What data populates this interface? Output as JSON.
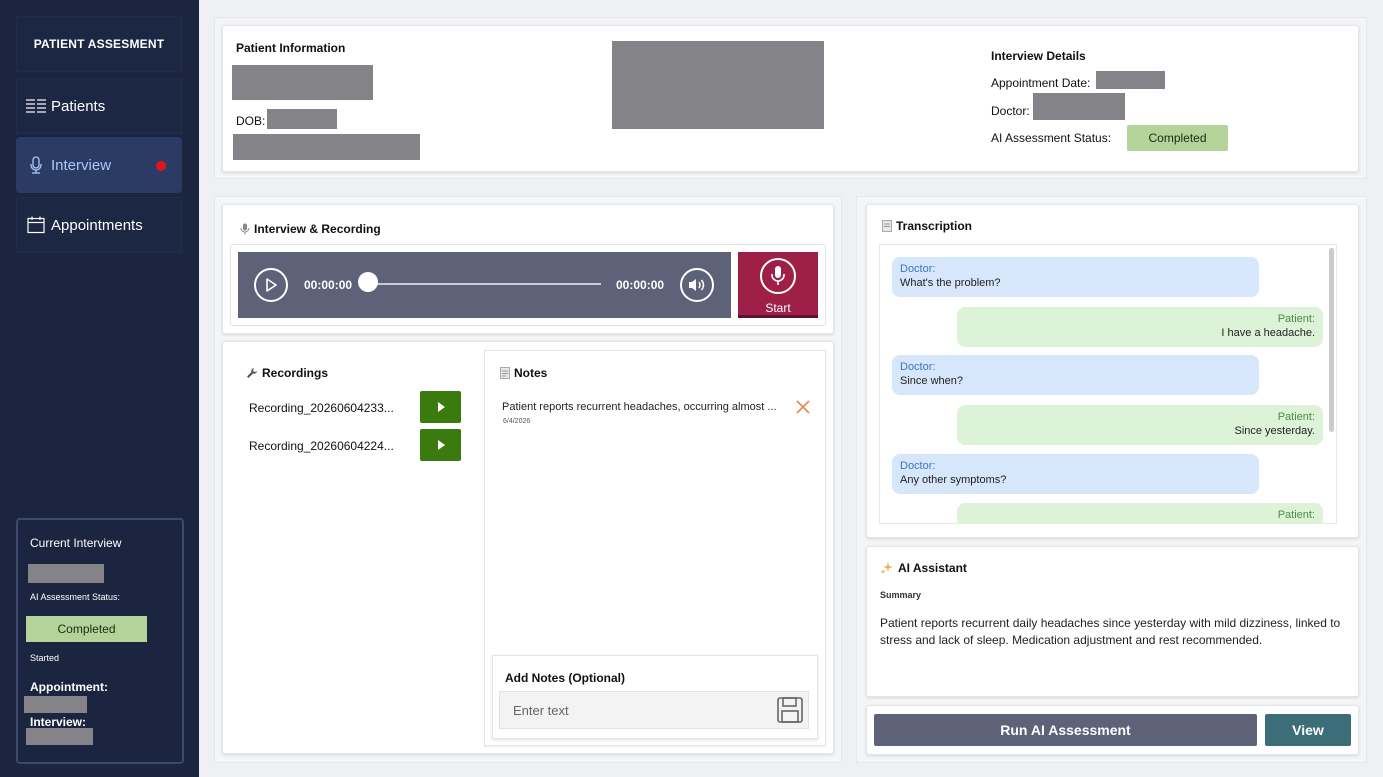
{
  "sidebar": {
    "brand": "PATIENT ASSESMENT",
    "items": [
      {
        "label": "Patients",
        "icon": "list-icon"
      },
      {
        "label": "Interview",
        "icon": "microphone-icon"
      },
      {
        "label": "Appointments",
        "icon": "calendar-icon"
      }
    ],
    "current": {
      "title": "Current Interview",
      "ai_status_label": "AI Assessment Status:",
      "ai_status": "Completed",
      "started": "Started",
      "appointment_label": "Appointment:",
      "interview_label": "Interview:"
    }
  },
  "patient_info": {
    "title": "Patient Information",
    "dob_label": "DOB:"
  },
  "interview_details": {
    "title": "Interview Details",
    "appointment_date_label": "Appointment Date:",
    "doctor_label": "Doctor:",
    "ai_status_label": "AI Assessment Status:",
    "ai_status": "Completed"
  },
  "recording": {
    "title": "Interview & Recording",
    "time_current": "00:00:00",
    "time_total": "00:00:00",
    "start_label": "Start"
  },
  "recordings": {
    "title": "Recordings",
    "items": [
      "Recording_20260604233...",
      "Recording_20260604224..."
    ]
  },
  "notes": {
    "title": "Notes",
    "items": [
      {
        "text": "Patient reports recurrent headaches, occurring almost ...",
        "date": "6/4/2026"
      }
    ],
    "add_title": "Add Notes (Optional)",
    "placeholder": "Enter text"
  },
  "transcription": {
    "title": "Transcription",
    "messages": [
      {
        "speaker": "Doctor:",
        "text": "What's the problem?"
      },
      {
        "speaker": "Patient:",
        "text": "I have a headache."
      },
      {
        "speaker": "Doctor:",
        "text": "Since when?"
      },
      {
        "speaker": "Patient:",
        "text": "Since yesterday."
      },
      {
        "speaker": "Doctor:",
        "text": "Any other symptoms?"
      },
      {
        "speaker": "Patient:",
        "text": ""
      }
    ]
  },
  "ai_assistant": {
    "title": "AI Assistant",
    "summary_label": "Summary",
    "summary": "Patient reports recurrent daily headaches since yesterday with mild dizziness, linked to stress and lack of sleep. Medication adjustment and rest recommended."
  },
  "actions": {
    "run_label": "Run AI Assessment",
    "view_label": "View"
  },
  "colors": {
    "sidebar_bg": "#1b2540",
    "active_nav": "#2c3b63",
    "completed_badge": "#b3d39a",
    "record_button": "#9e1f48",
    "play_button": "#3a7a0e",
    "run_button": "#5d6279",
    "view_button": "#3b6e78"
  }
}
